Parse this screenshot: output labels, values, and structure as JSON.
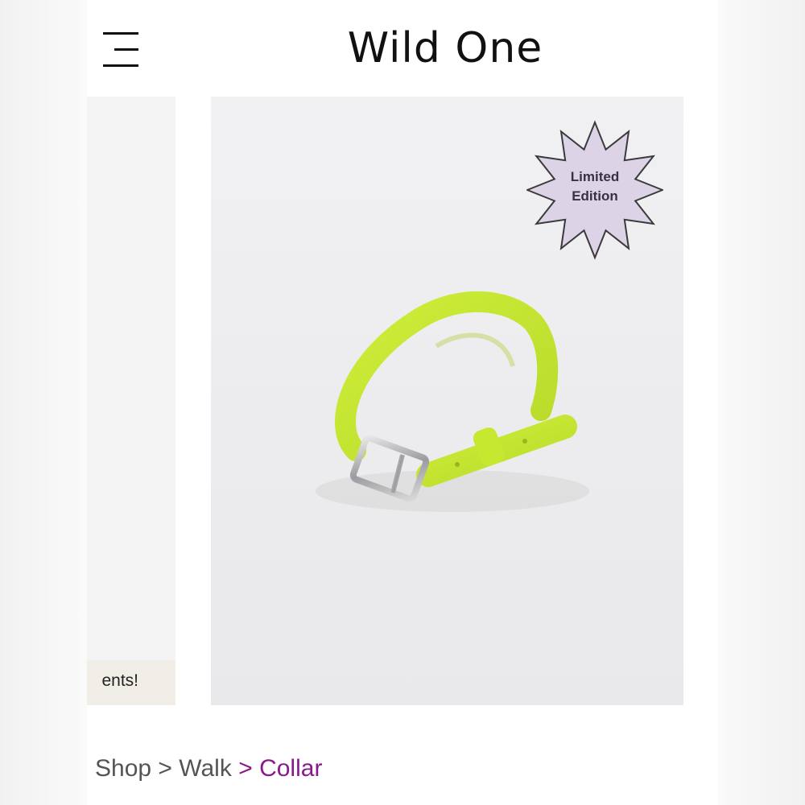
{
  "header": {
    "brand": "Wild One",
    "menu_icon": "hamburger-menu-icon"
  },
  "previous_slide": {
    "caption_fragment": "ents!"
  },
  "product": {
    "badge": {
      "line1": "Limited",
      "line2": "Edition",
      "color": "#ddd3e6"
    },
    "collar_color": "#c4e532"
  },
  "breadcrumb": {
    "items": [
      "Shop",
      "Walk",
      "Collar"
    ],
    "separator": ">",
    "current_color": "#8a1a8a"
  }
}
